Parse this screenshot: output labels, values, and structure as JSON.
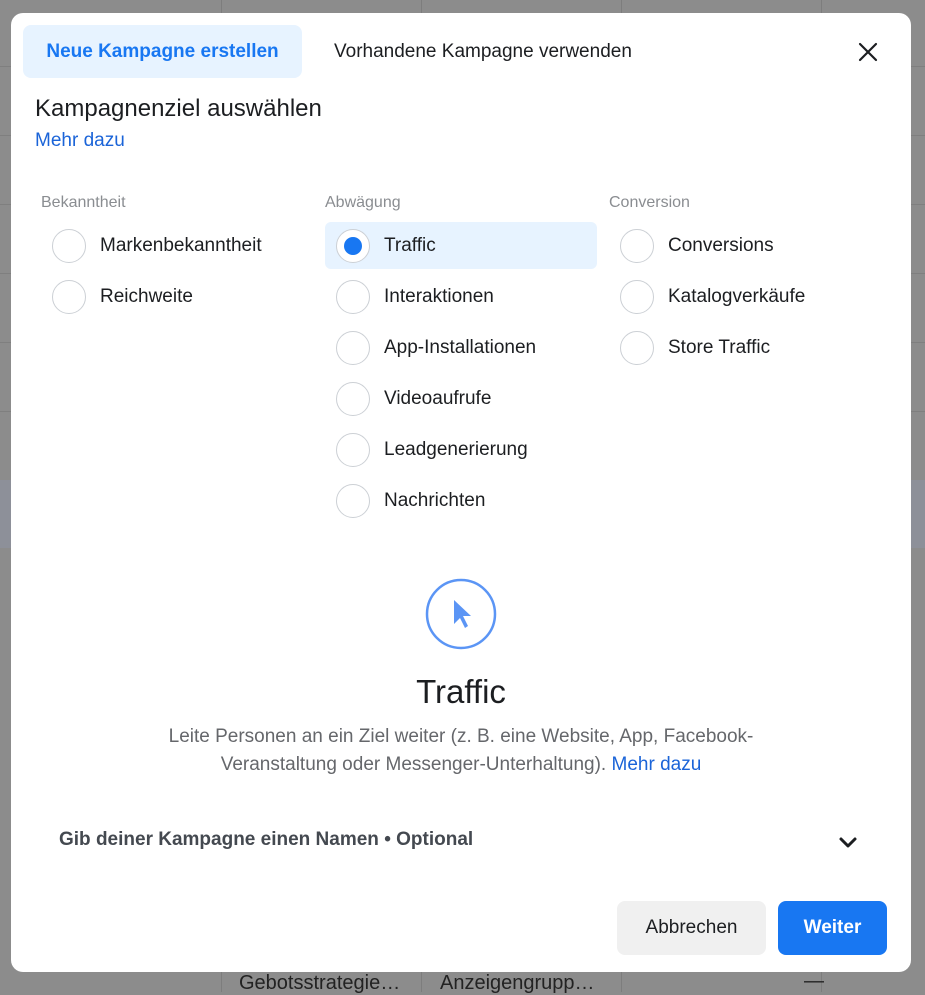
{
  "background": {
    "bottom_cells": [
      "Gebotsstrategie…",
      "Anzeigengrupp…",
      "—"
    ]
  },
  "modal": {
    "tabs": [
      {
        "label": "Neue Kampagne erstellen",
        "active": true
      },
      {
        "label": "Vorhandene Kampagne verwenden",
        "active": false
      }
    ],
    "close_icon": "close-icon",
    "title": "Kampagnenziel auswählen",
    "learn_more": "Mehr dazu",
    "columns": [
      {
        "heading": "Bekanntheit",
        "options": [
          "Markenbekanntheit",
          "Reichweite"
        ]
      },
      {
        "heading": "Abwägung",
        "options": [
          "Traffic",
          "Interaktionen",
          "App-Installationen",
          "Videoaufrufe",
          "Leadgenerierung",
          "Nachrichten"
        ]
      },
      {
        "heading": "Conversion",
        "options": [
          "Conversions",
          "Katalogverkäufe",
          "Store Traffic"
        ]
      }
    ],
    "selected": "Traffic",
    "detail": {
      "icon": "cursor-pointer-icon",
      "title": "Traffic",
      "description": "Leite Personen an ein Ziel weiter (z. B. eine Website, App, Facebook-Veranstaltung oder Messenger-Unterhaltung).",
      "link": "Mehr dazu"
    },
    "campaign_name_label": "Gib deiner Kampagne einen Namen • Optional",
    "buttons": {
      "cancel": "Abbrechen",
      "next": "Weiter"
    },
    "colors": {
      "accent": "#1877f2",
      "selected_bg": "#e7f3ff"
    }
  }
}
